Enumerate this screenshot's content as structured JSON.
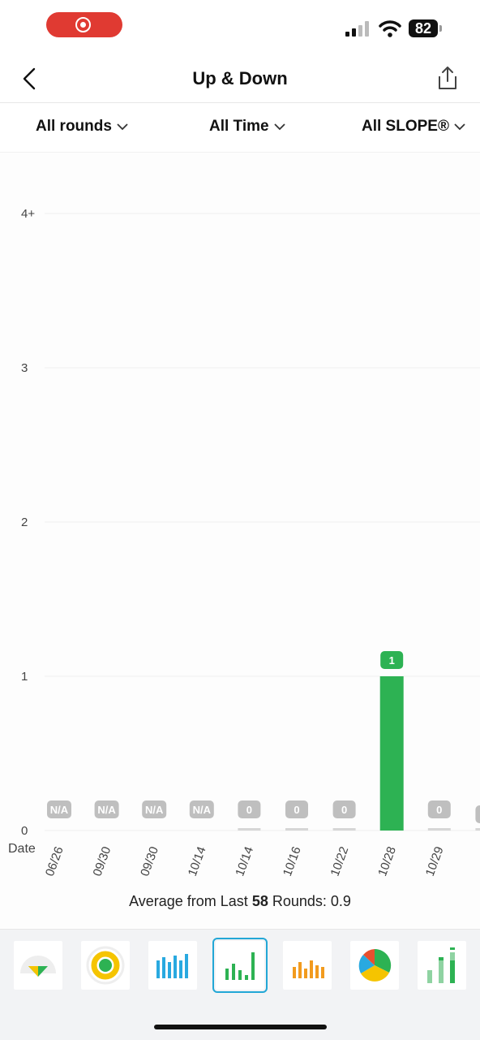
{
  "status_bar": {
    "battery": "82"
  },
  "nav": {
    "title": "Up & Down"
  },
  "filters": {
    "rounds": "All rounds",
    "time": "All Time",
    "slope": "All SLOPE®"
  },
  "chart_data": {
    "type": "bar",
    "xlabel": "Date",
    "ylabel": "",
    "y_ticks": [
      "0",
      "1",
      "2",
      "3",
      "4+"
    ],
    "ylim": [
      0,
      4
    ],
    "categories": [
      "06/26",
      "09/30",
      "09/30",
      "10/14",
      "10/14",
      "10/16",
      "10/22",
      "10/28",
      "10/29",
      ""
    ],
    "values": [
      null,
      null,
      null,
      null,
      0,
      0,
      0,
      1,
      0,
      0
    ],
    "labels": [
      "N/A",
      "N/A",
      "N/A",
      "N/A",
      "0",
      "0",
      "0",
      "1",
      "0",
      ""
    ],
    "colors": {
      "bar": "#2db253",
      "label_bg_grey": "#bfbfbf",
      "label_bg_green": "#2db253"
    }
  },
  "summary": {
    "prefix": "Average from Last ",
    "rounds": "58",
    "suffix": " Rounds: 0.9"
  },
  "chart_types": [
    {
      "icon": "gauge-chart-icon",
      "active": false
    },
    {
      "icon": "donut-chart-icon",
      "active": false
    },
    {
      "icon": "blue-bar-chart-icon",
      "active": false
    },
    {
      "icon": "green-bar-chart-icon",
      "active": true
    },
    {
      "icon": "orange-bar-chart-icon",
      "active": false
    },
    {
      "icon": "pie-chart-icon",
      "active": false
    },
    {
      "icon": "stacked-bar-chart-icon",
      "active": false
    }
  ]
}
